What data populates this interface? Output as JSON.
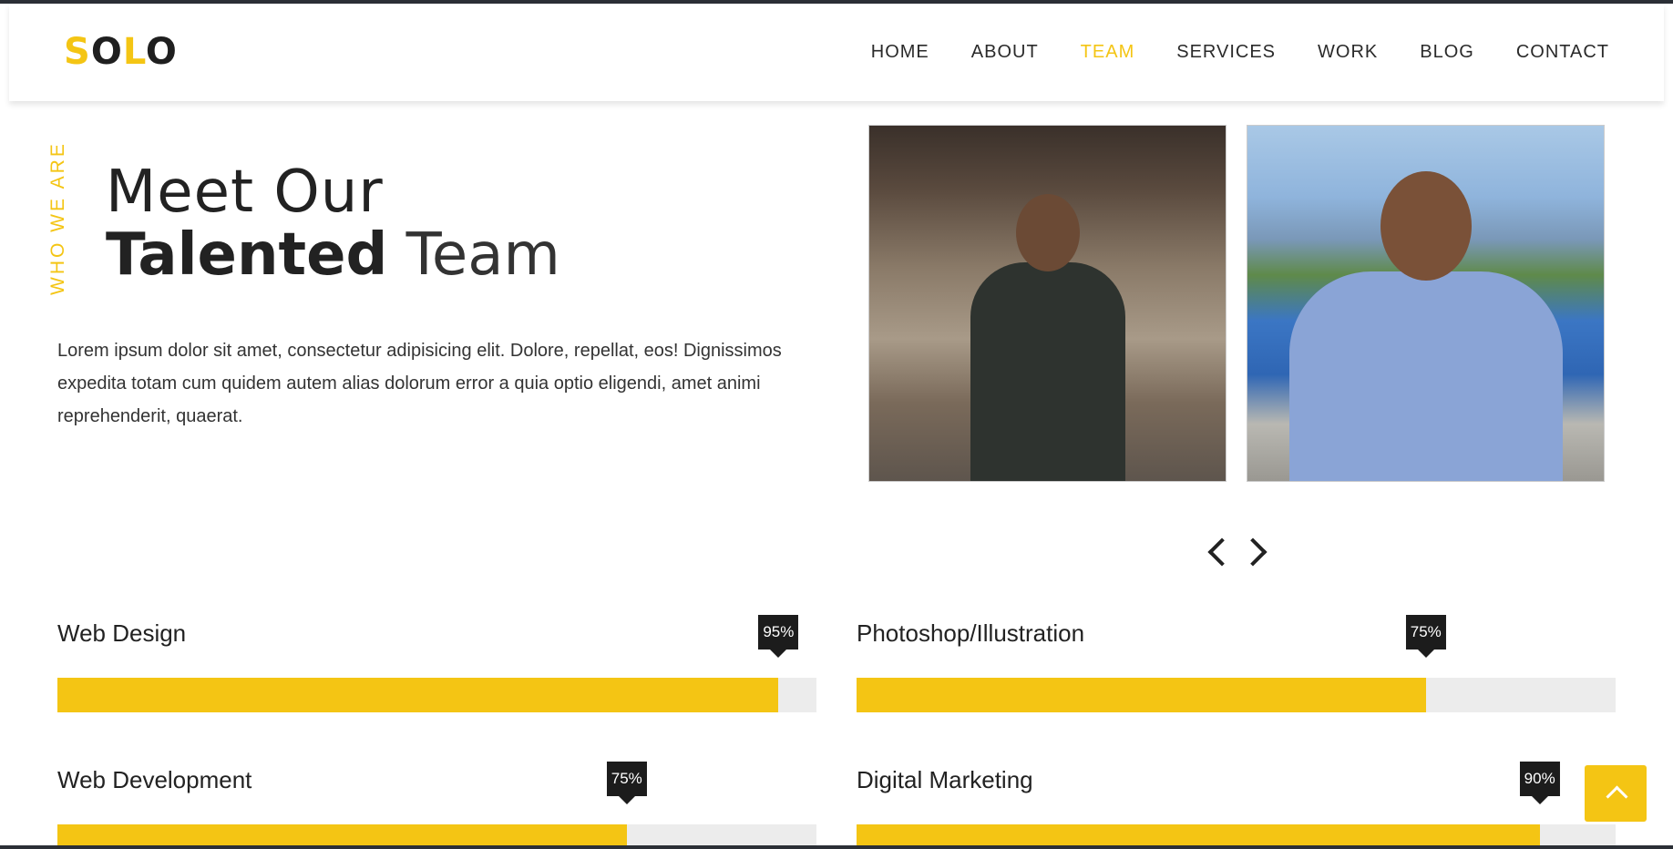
{
  "header": {
    "logo": {
      "part1": "S",
      "part2": "O",
      "part3": "L",
      "part4": "O"
    },
    "nav": [
      {
        "label": "HOME"
      },
      {
        "label": "ABOUT"
      },
      {
        "label": "TEAM"
      },
      {
        "label": "SERVICES"
      },
      {
        "label": "WORK"
      },
      {
        "label": "BLOG"
      },
      {
        "label": "CONTACT"
      }
    ],
    "active_nav": "TEAM"
  },
  "section": {
    "vertical_label": "WHO WE ARE",
    "title_line1": "Meet Our",
    "title_bold": "Talented",
    "title_light": " Team",
    "intro": "Lorem ipsum dolor sit amet, consectetur adipisicing elit. Dolore, repellat, eos! Dignissimos expedita totam cum quidem autem alias dolorum error a quia optio eligendi, amet animi reprehenderit, quaerat."
  },
  "slider": {
    "prev_icon": "chevron-left-icon",
    "next_icon": "chevron-right-icon"
  },
  "skills": [
    {
      "label": "Web Design",
      "percent_text": "95%",
      "percent": 95
    },
    {
      "label": "Photoshop/Illustration",
      "percent_text": "75%",
      "percent": 75
    },
    {
      "label": "Web Development",
      "percent_text": "75%",
      "percent": 75
    },
    {
      "label": "Digital Marketing",
      "percent_text": "90%",
      "percent": 90
    }
  ],
  "colors": {
    "accent": "#f4c514",
    "dark": "#1c1c1c",
    "track": "#ececec"
  },
  "back_to_top_icon": "chevron-up-icon"
}
